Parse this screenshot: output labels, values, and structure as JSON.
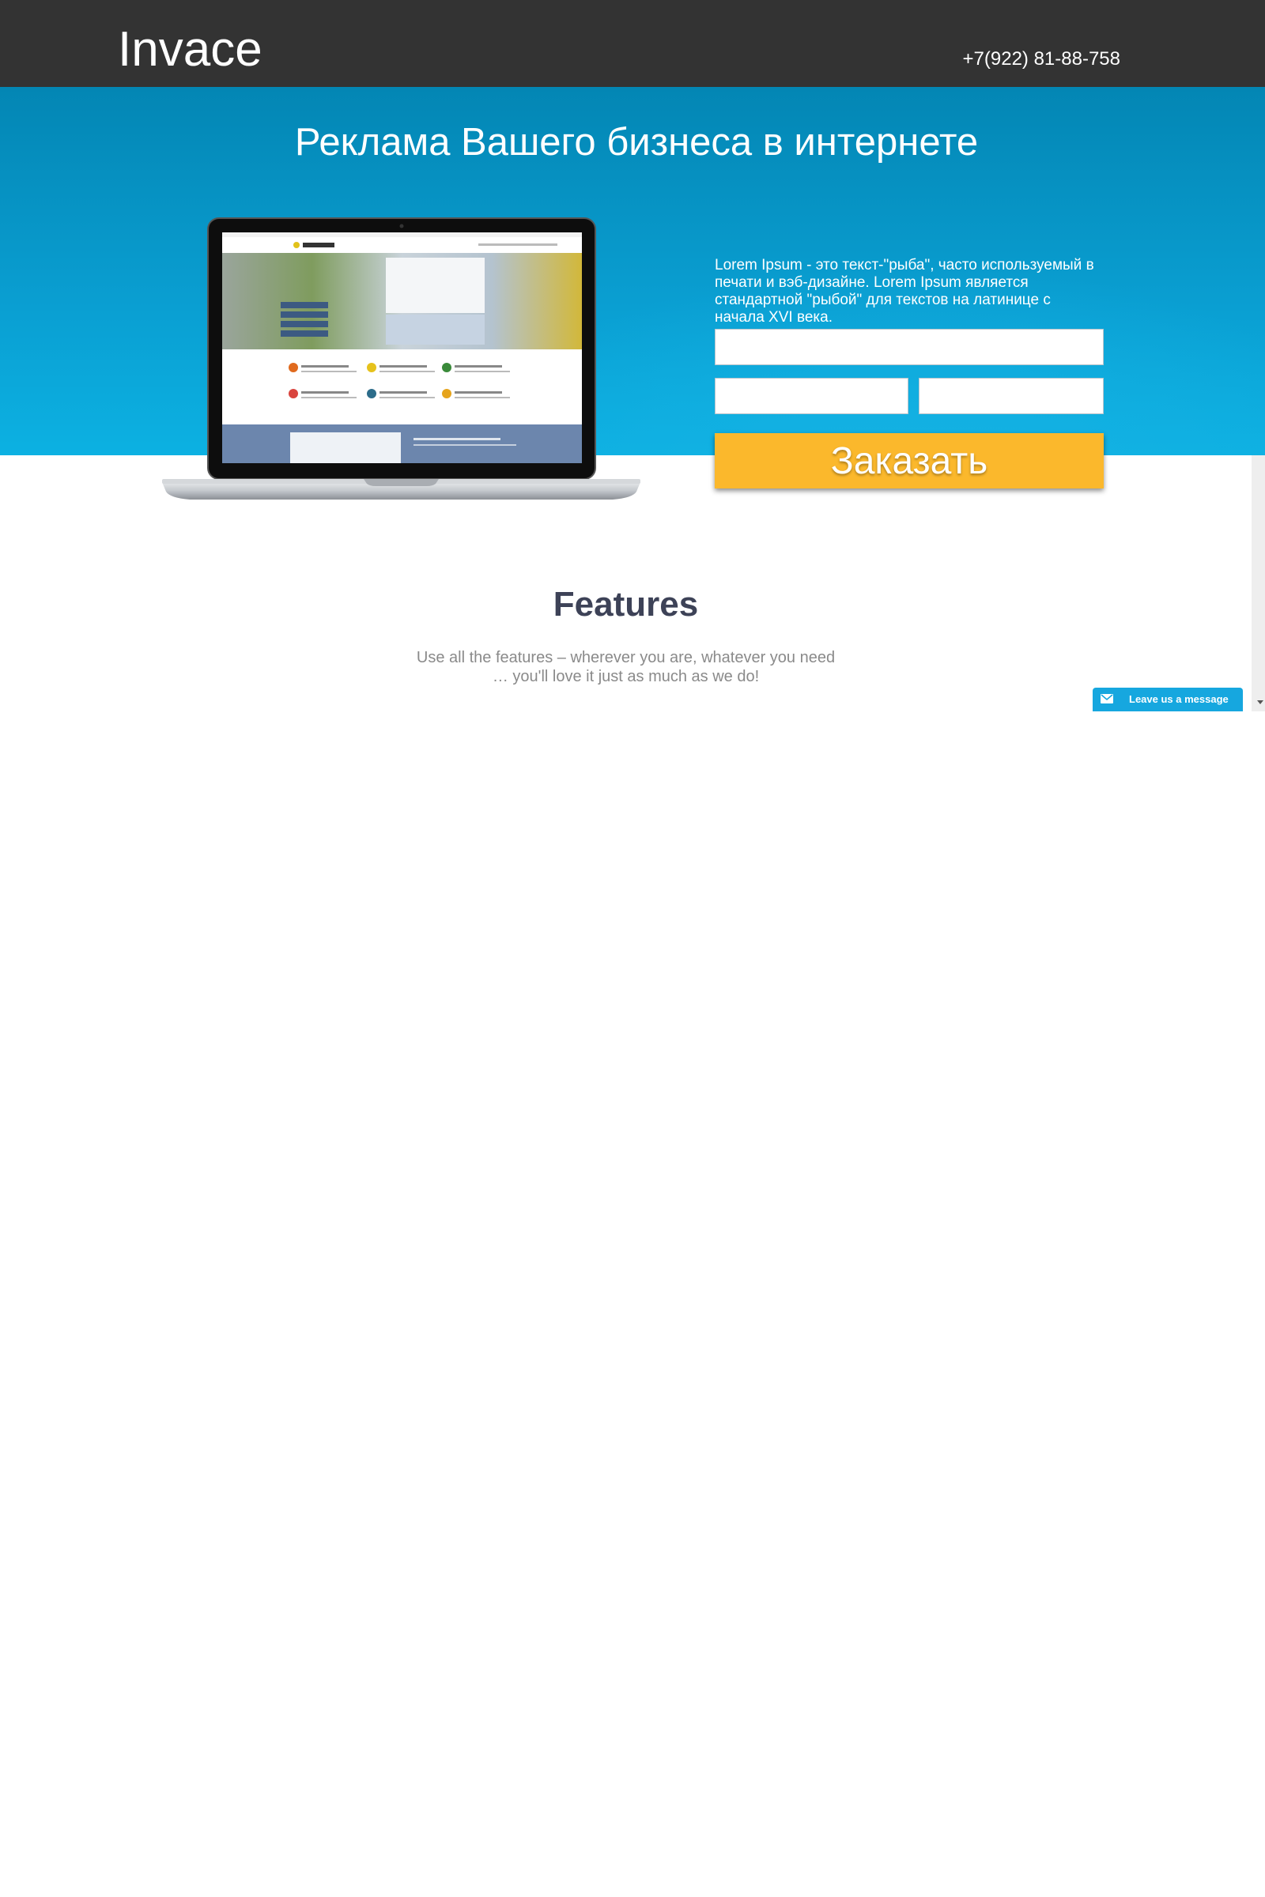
{
  "header": {
    "logo": "Invace",
    "phone": "+7(922) 81-88-758"
  },
  "hero": {
    "title": "Реклама Вашего бизнеса в интернете",
    "description": "Lorem Ipsum - это текст-\"рыба\", часто используемый в печати и вэб-дизайне. Lorem Ipsum является стандартной \"рыбой\" для текстов на латинице с начала XVI века.",
    "form": {
      "name_value": "",
      "phone_value": "",
      "email_value": "",
      "submit_label": "Заказать"
    },
    "laptop_screen": {
      "site_logo": "wdstudio"
    }
  },
  "features": {
    "title": "Features",
    "subtitle_line1": "Use all the features – wherever you are, whatever you need",
    "subtitle_line2": "… you'll love it just as much as we do!"
  },
  "chat_widget": {
    "label": "Leave us a message",
    "icon": "envelope-icon"
  },
  "colors": {
    "header_bg": "#333333",
    "hero_blue": "#0a9fd2",
    "button_yellow": "#fbb82c",
    "chat_blue": "#16a7df",
    "features_title": "#3d4257"
  }
}
